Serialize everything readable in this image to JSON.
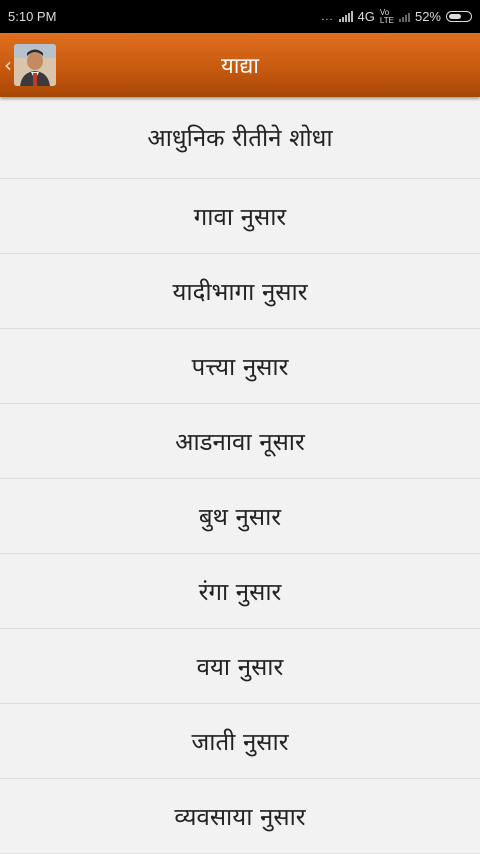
{
  "status_bar": {
    "time": "5:10 PM",
    "dots": "...",
    "network_type": "4G",
    "volte_top": "Vo",
    "volte_bottom": "LTE",
    "battery_percent": "52%",
    "battery_level": 0.52
  },
  "header": {
    "title": "याद्या",
    "back_icon": "chevron-left-icon",
    "avatar": "profile-photo",
    "color": "#c85a10"
  },
  "menu": {
    "items": [
      {
        "label": "आधुनिक रीतीने शोधा"
      },
      {
        "label": "गावा नुसार"
      },
      {
        "label": "यादीभागा नुसार"
      },
      {
        "label": "पत्त्या नुसार"
      },
      {
        "label": "आडनावा नूसार"
      },
      {
        "label": "बुथ नुसार"
      },
      {
        "label": "रंगा नुसार"
      },
      {
        "label": "वया नुसार"
      },
      {
        "label": "जाती नुसार"
      },
      {
        "label": "व्यवसाया नुसार"
      }
    ]
  }
}
